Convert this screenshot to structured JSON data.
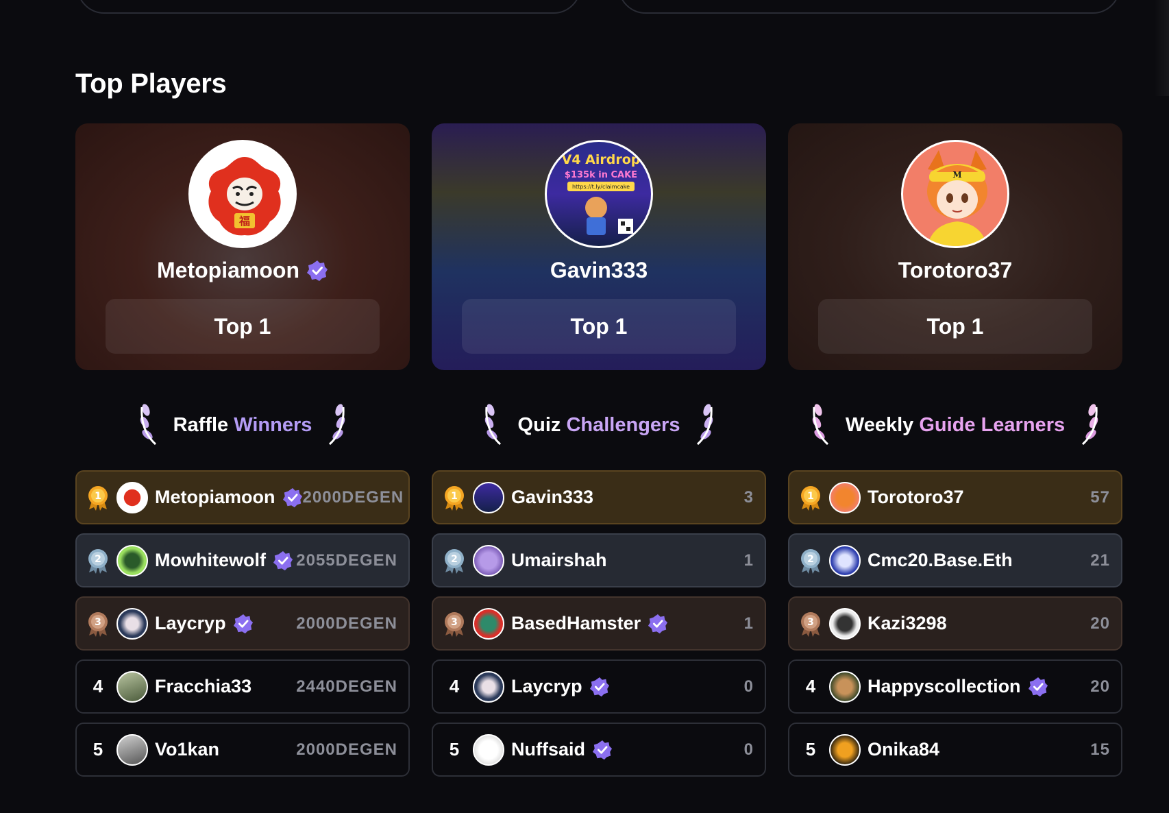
{
  "section": {
    "title": "Top Players"
  },
  "colors": {
    "verified": "#8b6ff0",
    "gold": "#f5a623",
    "silver": "#8fb0c8",
    "bronze": "#b07a5c"
  },
  "top_cards": [
    {
      "name": "Metopiamoon",
      "verified": true,
      "button": "Top 1",
      "avatar": "daruma-avatar"
    },
    {
      "name": "Gavin333",
      "verified": false,
      "button": "Top 1",
      "avatar": "v4-airdrop-avatar",
      "avatar_text": {
        "line1": "V4 Airdrop",
        "line2": "$135k in CAKE",
        "line3": "https://t.ly/claimcake"
      }
    },
    {
      "name": "Torotoro37",
      "verified": false,
      "button": "Top 1",
      "avatar": "anime-fox-girl-avatar"
    }
  ],
  "boards": [
    {
      "title_a": "Raffle",
      "title_b": "Winners",
      "rows": [
        {
          "rank": "1",
          "name": "Metopiamoon",
          "verified": true,
          "value": "2000DEGEN"
        },
        {
          "rank": "2",
          "name": "Mowhitewolf",
          "verified": true,
          "value": "2055DEGEN"
        },
        {
          "rank": "3",
          "name": "Laycryp",
          "verified": true,
          "value": "2000DEGEN"
        },
        {
          "rank": "4",
          "name": "Fracchia33",
          "verified": false,
          "value": "2440DEGEN"
        },
        {
          "rank": "5",
          "name": "Vo1kan",
          "verified": false,
          "value": "2000DEGEN"
        }
      ]
    },
    {
      "title_a": "Quiz",
      "title_b": "Challengers",
      "rows": [
        {
          "rank": "1",
          "name": "Gavin333",
          "verified": false,
          "value": "3"
        },
        {
          "rank": "2",
          "name": "Umairshah",
          "verified": false,
          "value": "1"
        },
        {
          "rank": "3",
          "name": "BasedHamster",
          "verified": true,
          "value": "1"
        },
        {
          "rank": "4",
          "name": "Laycryp",
          "verified": true,
          "value": "0"
        },
        {
          "rank": "5",
          "name": "Nuffsaid",
          "verified": true,
          "value": "0"
        }
      ]
    },
    {
      "title_a": "Weekly",
      "title_b": "Guide Learners",
      "rows": [
        {
          "rank": "1",
          "name": "Torotoro37",
          "verified": false,
          "value": "57"
        },
        {
          "rank": "2",
          "name": "Cmc20.Base.Eth",
          "verified": false,
          "value": "21"
        },
        {
          "rank": "3",
          "name": "Kazi3298",
          "verified": false,
          "value": "20"
        },
        {
          "rank": "4",
          "name": "Happyscollection",
          "verified": true,
          "value": "20"
        },
        {
          "rank": "5",
          "name": "Onika84",
          "verified": false,
          "value": "15"
        }
      ]
    }
  ]
}
